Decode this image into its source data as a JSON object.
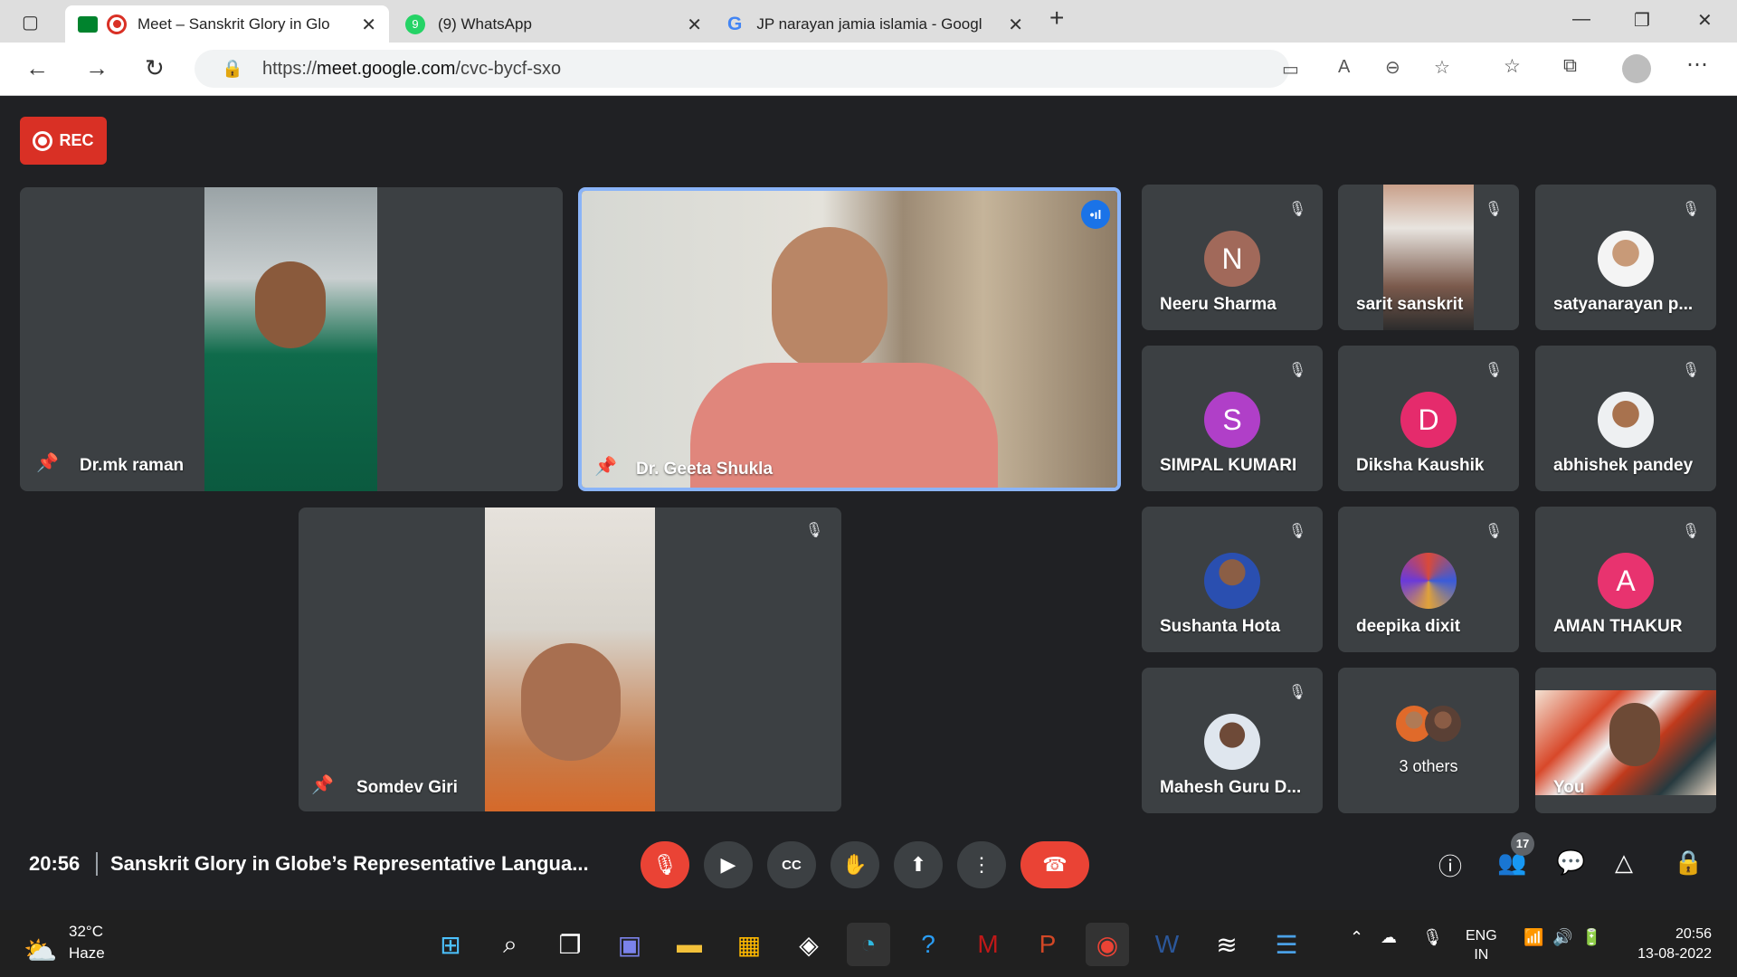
{
  "browser": {
    "tabs": [
      {
        "title": "Meet – Sanskrit Glory in Glo",
        "active": true
      },
      {
        "title": "(9) WhatsApp",
        "active": false
      },
      {
        "title": "JP narayan jamia islamia - Googl",
        "active": false
      }
    ],
    "url_prefix": "https://",
    "url_host": "meet.google.com",
    "url_path": "/cvc-bycf-sxo"
  },
  "meet": {
    "rec_label": "REC",
    "main_tiles": [
      {
        "name": "Dr.mk raman",
        "pinned": true
      },
      {
        "name": "Dr. Geeta Shukla",
        "pinned": true,
        "speaking": true
      },
      {
        "name": "Somdev Giri",
        "pinned": true,
        "muted": true
      }
    ],
    "grid": [
      {
        "name": "Neeru Sharma",
        "initial": "N",
        "color": "#a1695a"
      },
      {
        "name": "sarit sanskrit",
        "video": true
      },
      {
        "name": "satyanarayan p...",
        "photo": true
      },
      {
        "name": "SIMPAL KUMARI",
        "initial": "S",
        "color": "#b03fc8"
      },
      {
        "name": "Diksha Kaushik",
        "initial": "D",
        "color": "#e52b6c"
      },
      {
        "name": "abhishek pandey",
        "photo": true
      },
      {
        "name": "Sushanta Hota",
        "photo": true
      },
      {
        "name": "deepika dixit",
        "photo": true
      },
      {
        "name": "AMAN THAKUR",
        "initial": "A",
        "color": "#e8336f"
      },
      {
        "name": "Mahesh Guru D...",
        "photo": true
      },
      {
        "name": "3 others"
      },
      {
        "name": "You",
        "video": true
      }
    ],
    "bottom": {
      "time": "20:56",
      "title": "Sanskrit Glory in Globe’s Representative Langua...",
      "people_count": "17"
    }
  },
  "taskbar": {
    "temp": "32°C",
    "weather": "Haze",
    "lang1": "ENG",
    "lang2": "IN",
    "time": "20:56",
    "date": "13-08-2022"
  }
}
